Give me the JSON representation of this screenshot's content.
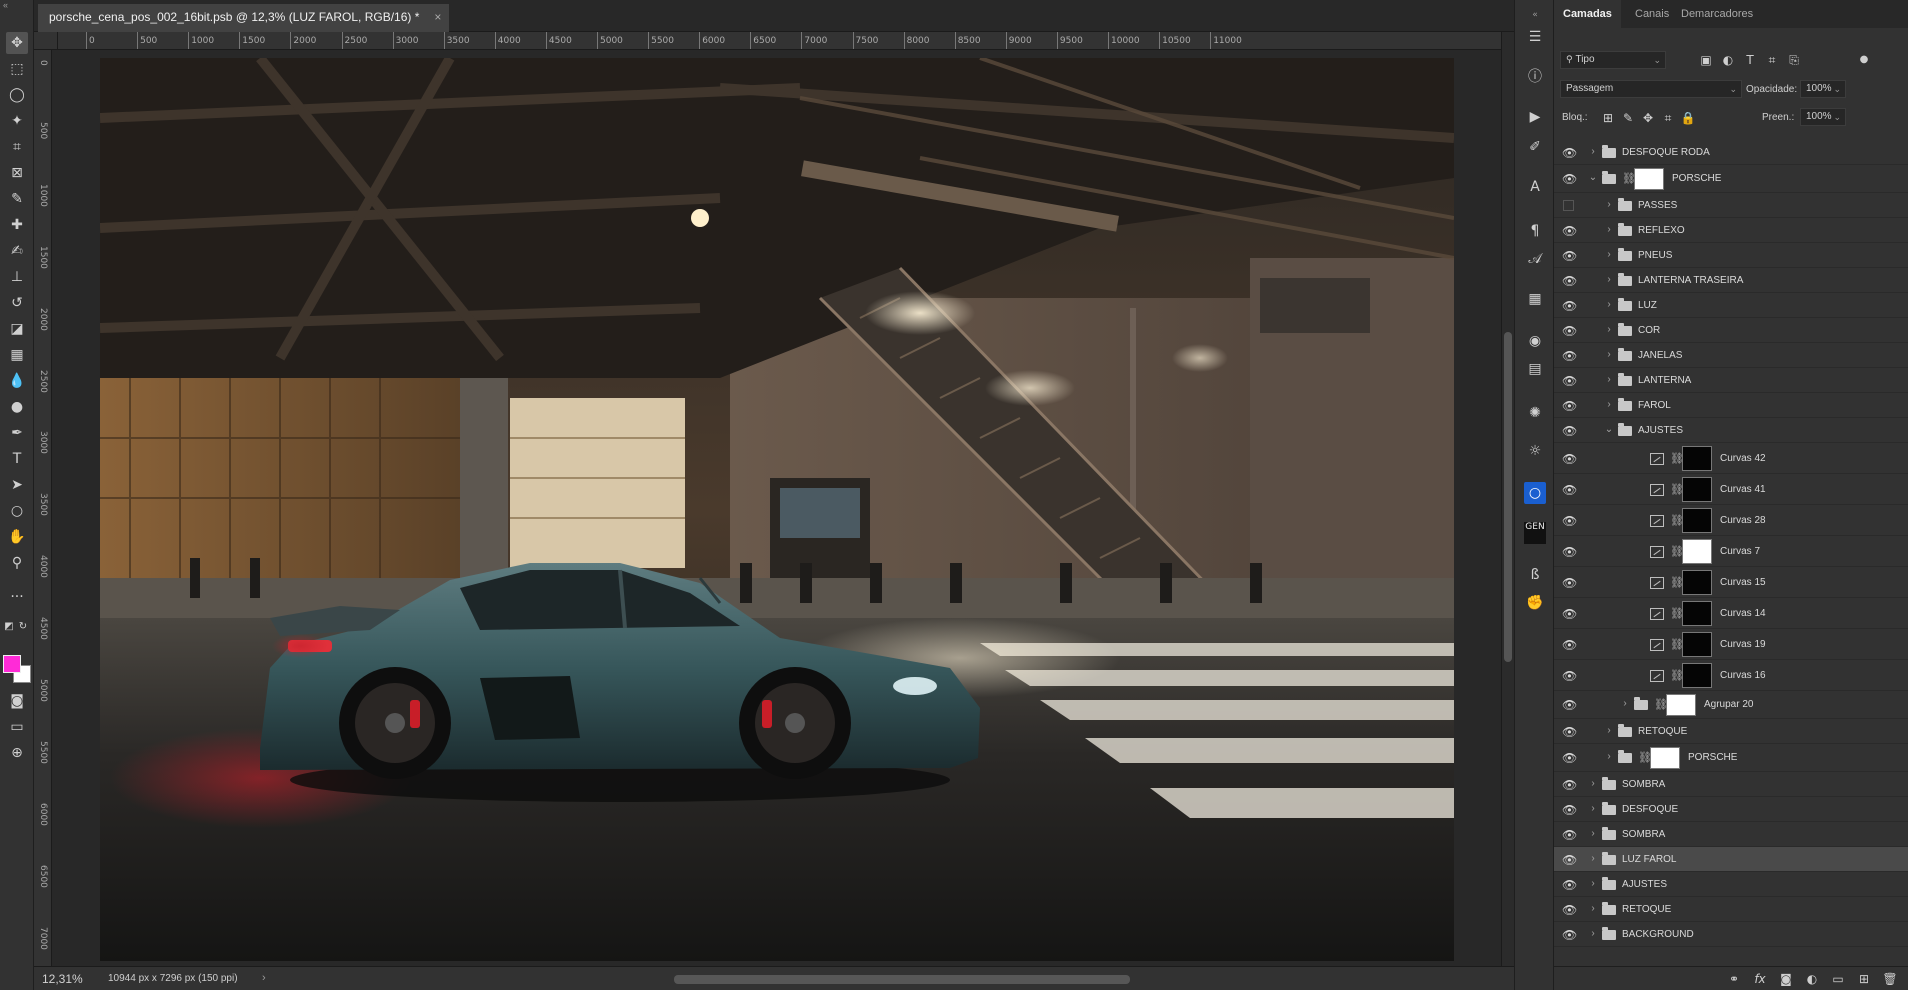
{
  "document": {
    "tab_title": "porsche_cena_pos_002_16bit.psb @ 12,3% (LUZ FAROL, RGB/16) *",
    "close_glyph": "×"
  },
  "ruler": {
    "h_ticks": [
      "0",
      "500",
      "1000",
      "1500",
      "2000",
      "2500",
      "3000",
      "3500",
      "4000",
      "4500",
      "5000",
      "5500",
      "6000",
      "6500",
      "7000",
      "7500",
      "8000",
      "8500",
      "9000",
      "9500",
      "10000",
      "10500",
      "11000"
    ],
    "v_ticks": [
      "0",
      "500",
      "1000",
      "1500",
      "2000",
      "2500",
      "3000",
      "3500",
      "4000",
      "4500",
      "5000",
      "5500",
      "6000",
      "6500",
      "7000"
    ]
  },
  "status": {
    "zoom": "12,31%",
    "doc_info": "10944 px x 7296 px (150 ppi)",
    "arrow": "›"
  },
  "colors": {
    "foreground": "#ff2bd7",
    "background": "#ffffff",
    "selection": "#4a4a4a"
  },
  "toolbar": {
    "tools": [
      "move-icon",
      "marquee-icon",
      "lasso-icon",
      "magic-wand-icon",
      "crop-icon",
      "frame-icon",
      "eyedropper-icon",
      "healing-icon",
      "brush-icon",
      "stamp-icon",
      "history-brush-icon",
      "eraser-icon",
      "gradient-icon",
      "blur-icon",
      "dodge-icon",
      "pen-icon",
      "type-icon",
      "path-select-icon",
      "ellipse-icon",
      "hand-icon",
      "zoom-icon",
      "more-icon"
    ]
  },
  "panel": {
    "tabs": [
      "Camadas",
      "Canais",
      "Demarcadores"
    ],
    "filter": {
      "value": "Tipo"
    },
    "blend_mode": "Passagem",
    "opacity_label": "Opacidade:",
    "opacity_value": "100%",
    "lock_label": "Bloq.:",
    "fill_label": "Preen.:",
    "fill_value": "100%"
  },
  "layers": [
    {
      "name": "DESFOQUE RODA",
      "kind": "folder",
      "indent": 0,
      "expanded": false,
      "visible": true
    },
    {
      "name": "PORSCHE",
      "kind": "folder-mask",
      "indent": 0,
      "expanded": true,
      "visible": true,
      "mask": "car"
    },
    {
      "name": "PASSES",
      "kind": "folder",
      "indent": 1,
      "expanded": false,
      "visible": false
    },
    {
      "name": "REFLEXO",
      "kind": "folder",
      "indent": 1,
      "expanded": false,
      "visible": true
    },
    {
      "name": "PNEUS",
      "kind": "folder",
      "indent": 1,
      "expanded": false,
      "visible": true
    },
    {
      "name": "LANTERNA TRASEIRA",
      "kind": "folder",
      "indent": 1,
      "expanded": false,
      "visible": true
    },
    {
      "name": "LUZ",
      "kind": "folder",
      "indent": 1,
      "expanded": false,
      "visible": true
    },
    {
      "name": "COR",
      "kind": "folder",
      "indent": 1,
      "expanded": false,
      "visible": true
    },
    {
      "name": "JANELAS",
      "kind": "folder",
      "indent": 1,
      "expanded": false,
      "visible": true
    },
    {
      "name": "LANTERNA",
      "kind": "folder",
      "indent": 1,
      "expanded": false,
      "visible": true
    },
    {
      "name": "FAROL",
      "kind": "folder",
      "indent": 1,
      "expanded": false,
      "visible": true
    },
    {
      "name": "AJUSTES",
      "kind": "folder",
      "indent": 1,
      "expanded": true,
      "visible": true
    },
    {
      "name": "Curvas 42",
      "kind": "adjust",
      "indent": 2,
      "visible": true,
      "mask": "dark-dash"
    },
    {
      "name": "Curvas 41",
      "kind": "adjust",
      "indent": 2,
      "visible": true,
      "mask": "dark-dash"
    },
    {
      "name": "Curvas 28",
      "kind": "adjust",
      "indent": 2,
      "visible": true,
      "mask": "dark-dot"
    },
    {
      "name": "Curvas 7",
      "kind": "adjust",
      "indent": 2,
      "visible": true,
      "mask": "white"
    },
    {
      "name": "Curvas 15",
      "kind": "adjust",
      "indent": 2,
      "visible": true,
      "mask": "dark-car"
    },
    {
      "name": "Curvas 14",
      "kind": "adjust",
      "indent": 2,
      "visible": true,
      "mask": "dark-car"
    },
    {
      "name": "Curvas 19",
      "kind": "adjust",
      "indent": 2,
      "visible": true,
      "mask": "dark-ground"
    },
    {
      "name": "Curvas 16",
      "kind": "adjust",
      "indent": 2,
      "visible": true,
      "mask": "dark-ground"
    },
    {
      "name": "Agrupar 20",
      "kind": "folder-mask",
      "indent": 2,
      "expanded": false,
      "visible": true,
      "mask": "white-dot"
    },
    {
      "name": "RETOQUE",
      "kind": "folder",
      "indent": 1,
      "expanded": false,
      "visible": true
    },
    {
      "name": "PORSCHE",
      "kind": "folder-mask",
      "indent": 1,
      "expanded": false,
      "visible": true,
      "mask": "white"
    },
    {
      "name": "SOMBRA",
      "kind": "folder",
      "indent": 0,
      "expanded": false,
      "visible": true
    },
    {
      "name": "DESFOQUE",
      "kind": "folder",
      "indent": 0,
      "expanded": false,
      "visible": true
    },
    {
      "name": "SOMBRA",
      "kind": "folder",
      "indent": 0,
      "expanded": false,
      "visible": true
    },
    {
      "name": "LUZ FAROL",
      "kind": "folder",
      "indent": 0,
      "expanded": false,
      "visible": true,
      "selected": true
    },
    {
      "name": "AJUSTES",
      "kind": "folder",
      "indent": 0,
      "expanded": false,
      "visible": true
    },
    {
      "name": "RETOQUE",
      "kind": "folder",
      "indent": 0,
      "expanded": false,
      "visible": true
    },
    {
      "name": "BACKGROUND",
      "kind": "folder",
      "indent": 0,
      "expanded": false,
      "visible": true
    }
  ]
}
